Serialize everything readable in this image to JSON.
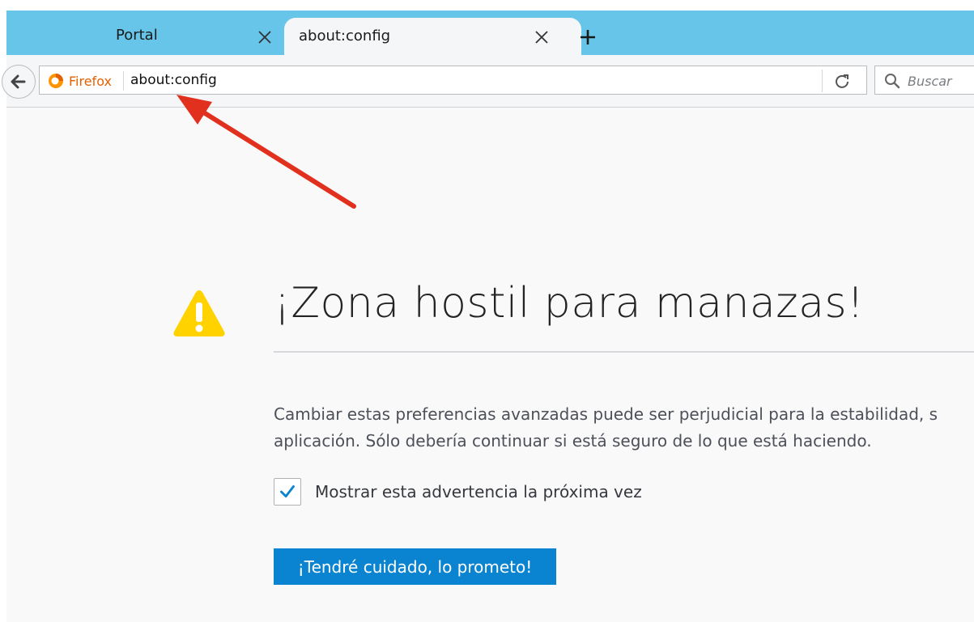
{
  "tabs": [
    {
      "label": "Portal",
      "active": false
    },
    {
      "label": "about:config",
      "active": true
    }
  ],
  "navbar": {
    "identity_label": "Firefox",
    "url": "about:config",
    "search_placeholder": "Buscar"
  },
  "page": {
    "title": "¡Zona hostil para manazas!",
    "description_line1": "Cambiar estas preferencias avanzadas puede ser perjudicial para la estabilidad, s",
    "description_line2": "aplicación. Sólo debería continuar si está seguro de lo que está haciendo.",
    "checkbox_label": "Mostrar esta advertencia la próxima vez",
    "checkbox_checked": true,
    "accept_button": "¡Tendré cuidado, lo prometo!"
  },
  "colors": {
    "tab_strip": "#66c5e8",
    "accent_button": "#0a84d0",
    "warning_icon": "#ffd200",
    "annotation_arrow": "#e2301f",
    "firefox_brand": "#e66000"
  },
  "icons": [
    "close-icon",
    "plus-icon",
    "back-arrow-icon",
    "firefox-logo-icon",
    "reload-icon",
    "search-icon",
    "warning-icon",
    "checkmark-icon"
  ]
}
